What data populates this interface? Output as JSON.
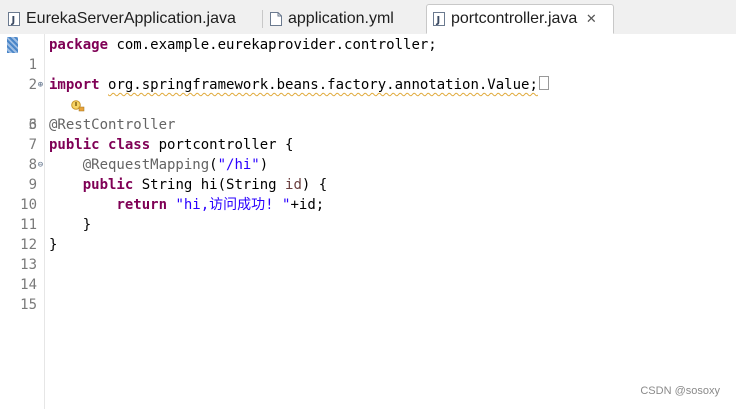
{
  "tabs": [
    {
      "label": "EurekaServerApplication.java",
      "icon": "java-file-icon",
      "active": false
    },
    {
      "label": "application.yml",
      "icon": "yml-file-icon",
      "active": false
    },
    {
      "label": "portcontroller.java",
      "icon": "java-file-icon",
      "active": true,
      "close": "✕"
    }
  ],
  "lines": [
    {
      "num": "1",
      "seg": [
        "package",
        " com.example.eurekaprovider.controller;"
      ]
    },
    {
      "num": "2"
    },
    {
      "num": "3",
      "fold": "⊕",
      "seg": [
        "import",
        " ",
        "org.springframework.beans.factory.annotation.Value;"
      ]
    },
    {
      "num": "6"
    },
    {
      "num": "7",
      "seg": [
        "@RestController"
      ]
    },
    {
      "num": "8",
      "seg": [
        "public",
        " ",
        "class",
        " portcontroller {"
      ]
    },
    {
      "num": "9",
      "fold": "⊖",
      "seg": [
        "    ",
        "@RequestMapping",
        "(",
        "\"/hi\"",
        ")"
      ]
    },
    {
      "num": "10",
      "seg": [
        "    ",
        "public",
        " String hi(String ",
        "id",
        ") {"
      ]
    },
    {
      "num": "11",
      "seg": [
        "        ",
        "return",
        " ",
        "\"hi,访问成功! \"",
        "+id;"
      ]
    },
    {
      "num": "12",
      "seg": [
        "    }"
      ]
    },
    {
      "num": "13",
      "seg": [
        "}"
      ]
    },
    {
      "num": "14"
    },
    {
      "num": "15"
    }
  ],
  "watermark": "CSDN @sosoxy",
  "colors": {
    "keyword": "#7f0055",
    "annotation": "#646464",
    "string": "#2a00ff",
    "variable": "#6a3e3e",
    "warning_underline": "#e0a93a"
  }
}
